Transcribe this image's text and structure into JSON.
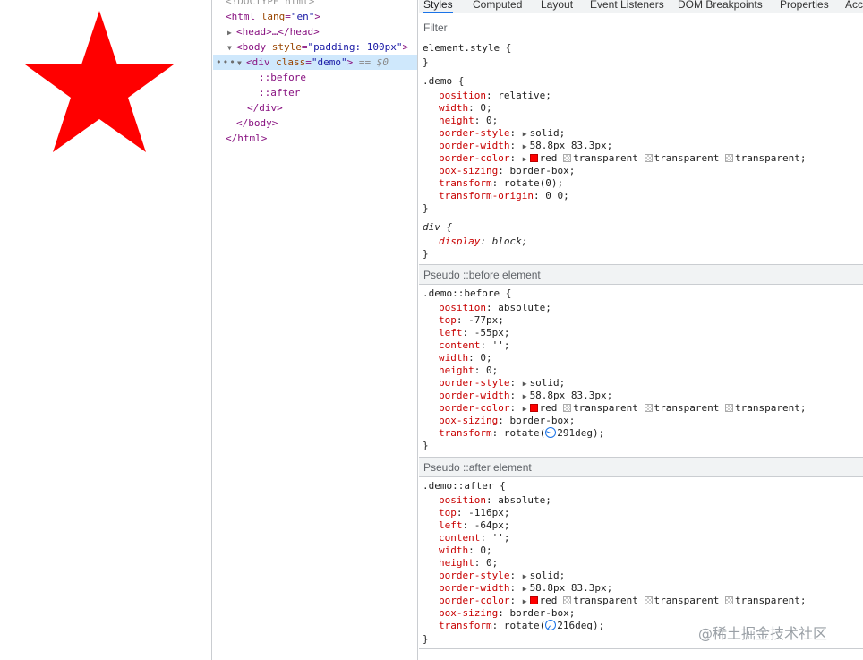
{
  "dom_tree": {
    "doctype": "<!DOCTYPE html>",
    "html_open_tag": "html",
    "html_lang_attr": "lang",
    "html_lang_value": "\"en\"",
    "head_collapsed": "<head>…</head>",
    "body_tag": "body",
    "body_style_attr": "style",
    "body_style_value": "\"padding: 100px\"",
    "div_tag": "div",
    "div_class_attr": "class",
    "div_class_value": "\"demo\"",
    "selected_ref": "== $0",
    "pseudo_before": "::before",
    "pseudo_after": "::after",
    "close_div": "</div>",
    "close_body": "</body>",
    "close_html": "</html>"
  },
  "tabs": [
    "Styles",
    "Computed",
    "Layout",
    "Event Listeners",
    "DOM Breakpoints",
    "Properties",
    "Acce"
  ],
  "filter": {
    "placeholder": "Filter"
  },
  "element_style": {
    "selector": "element.style {",
    "close": "}"
  },
  "demo_rule": {
    "selector": ".demo {",
    "props": [
      [
        "position",
        "relative;"
      ],
      [
        "width",
        "0;"
      ],
      [
        "height",
        "0;"
      ],
      [
        "border-style",
        "solid;"
      ],
      [
        "border-width",
        "58.8px 83.3px;"
      ],
      [
        "border-color",
        "red"
      ],
      [
        "box-sizing",
        "border-box;"
      ],
      [
        "transform",
        "rotate(0);"
      ],
      [
        "transform-origin",
        "0 0;"
      ]
    ],
    "close": "}"
  },
  "div_rule": {
    "selector": "div {",
    "prop": "display",
    "value": "block;",
    "close": "}"
  },
  "before_header": "Pseudo ::before element",
  "before_rule": {
    "selector": ".demo::before {",
    "props": [
      [
        "position",
        "absolute;"
      ],
      [
        "top",
        "-77px;"
      ],
      [
        "left",
        "-55px;"
      ],
      [
        "content",
        "'';"
      ],
      [
        "width",
        "0;"
      ],
      [
        "height",
        "0;"
      ],
      [
        "border-style",
        "solid;"
      ],
      [
        "border-width",
        "58.8px 83.3px;"
      ],
      [
        "border-color",
        "red"
      ],
      [
        "box-sizing",
        "border-box;"
      ],
      [
        "transform",
        "291deg);"
      ]
    ],
    "close": "}"
  },
  "after_header": "Pseudo ::after element",
  "after_rule": {
    "selector": ".demo::after {",
    "props": [
      [
        "position",
        "absolute;"
      ],
      [
        "top",
        "-116px;"
      ],
      [
        "left",
        "-64px;"
      ],
      [
        "content",
        "'';"
      ],
      [
        "width",
        "0;"
      ],
      [
        "height",
        "0;"
      ],
      [
        "border-style",
        "solid;"
      ],
      [
        "border-width",
        "58.8px 83.3px;"
      ],
      [
        "border-color",
        "red"
      ],
      [
        "box-sizing",
        "border-box;"
      ],
      [
        "transform",
        "216deg);"
      ]
    ],
    "close": "}"
  },
  "border_color_rest": [
    "transparent",
    "transparent",
    "transparent;"
  ],
  "rotate_prefix": "rotate(",
  "watermark": "@稀土掘金技术社区",
  "colors": {
    "star": "#ff0000",
    "accent": "#1a73e8",
    "prop_name": "#c80000"
  },
  "icons": {
    "expand": "triangle-right-icon",
    "collapse": "triangle-down-icon",
    "angle": "angle-clock-icon",
    "swatch": "color-swatch-icon"
  }
}
